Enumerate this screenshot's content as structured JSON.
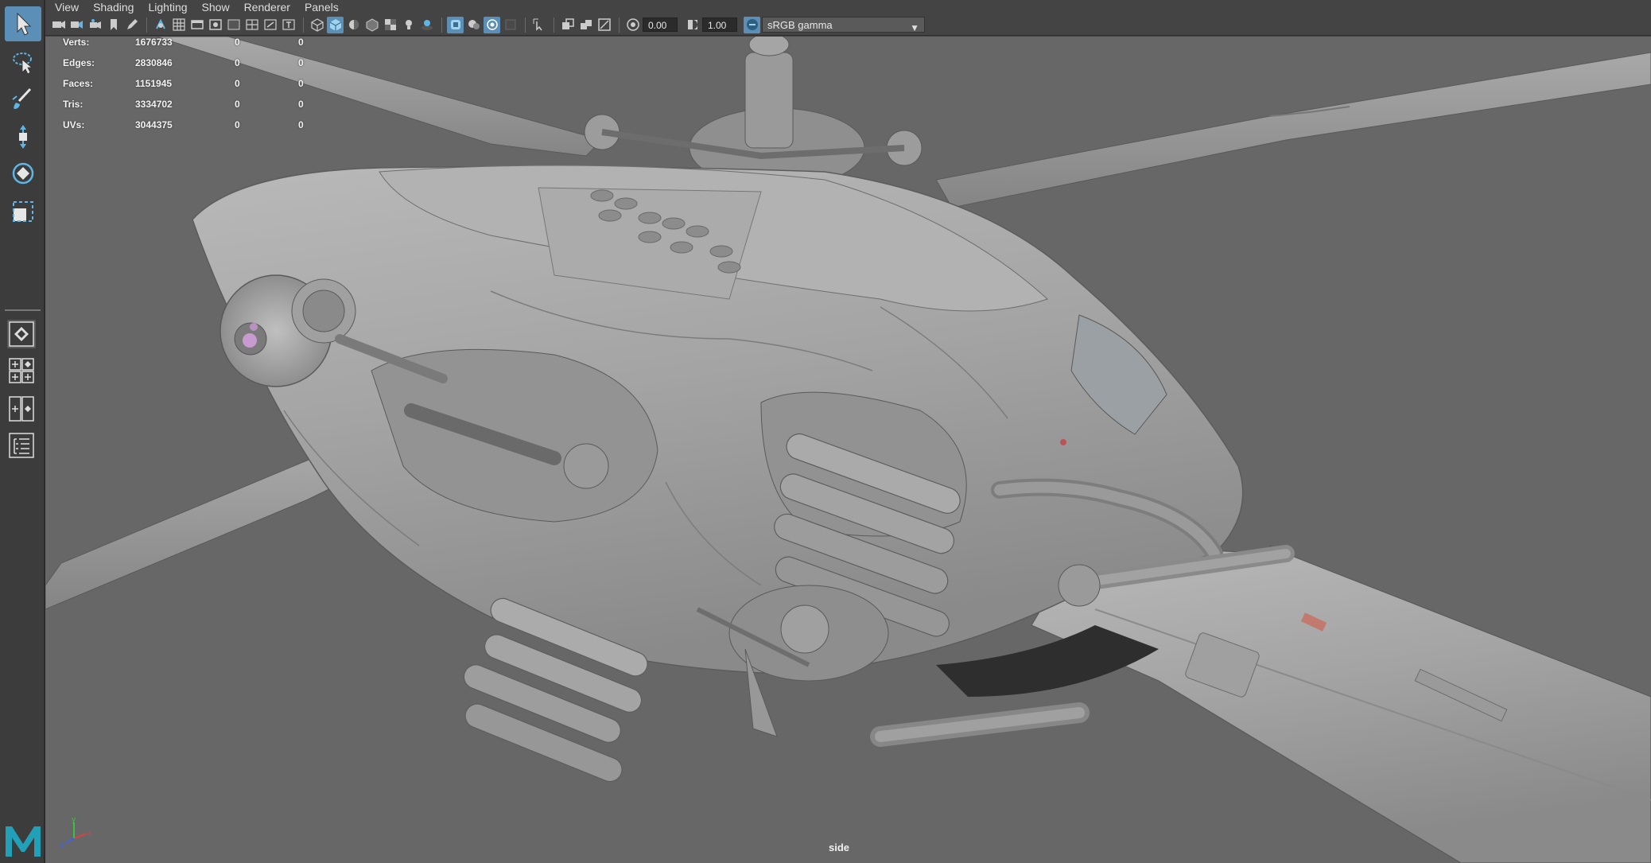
{
  "menu": [
    "View",
    "Shading",
    "Lighting",
    "Show",
    "Renderer",
    "Panels"
  ],
  "toolbar": {
    "exposure_value": "0.00",
    "gamma_value": "1.00",
    "color_space": "sRGB gamma",
    "dropdown_icon": "chevron-down-icon"
  },
  "toolbox": {
    "tools": [
      "select-tool",
      "lasso-tool",
      "paint-select-tool",
      "move-tool",
      "rotate-tool",
      "scale-tool"
    ],
    "layouts": [
      "single-pane-layout",
      "four-pane-layout",
      "two-pane-layout",
      "outliner-layout"
    ]
  },
  "hud": {
    "rows": [
      {
        "label": "Verts:",
        "v1": "1676733",
        "v2": "0",
        "v3": "0"
      },
      {
        "label": "Edges:",
        "v1": "2830846",
        "v2": "0",
        "v3": "0"
      },
      {
        "label": "Faces:",
        "v1": "1151945",
        "v2": "0",
        "v3": "0"
      },
      {
        "label": "Tris:",
        "v1": "3334702",
        "v2": "0",
        "v3": "0"
      },
      {
        "label": "UVs:",
        "v1": "3044375",
        "v2": "0",
        "v3": "0"
      }
    ]
  },
  "viewport": {
    "camera_name": "side",
    "background_color": "#676767",
    "model_color": "#a9a9a9"
  },
  "colors": {
    "accent": "#5b8fb8",
    "logo": "#22a0b8"
  }
}
